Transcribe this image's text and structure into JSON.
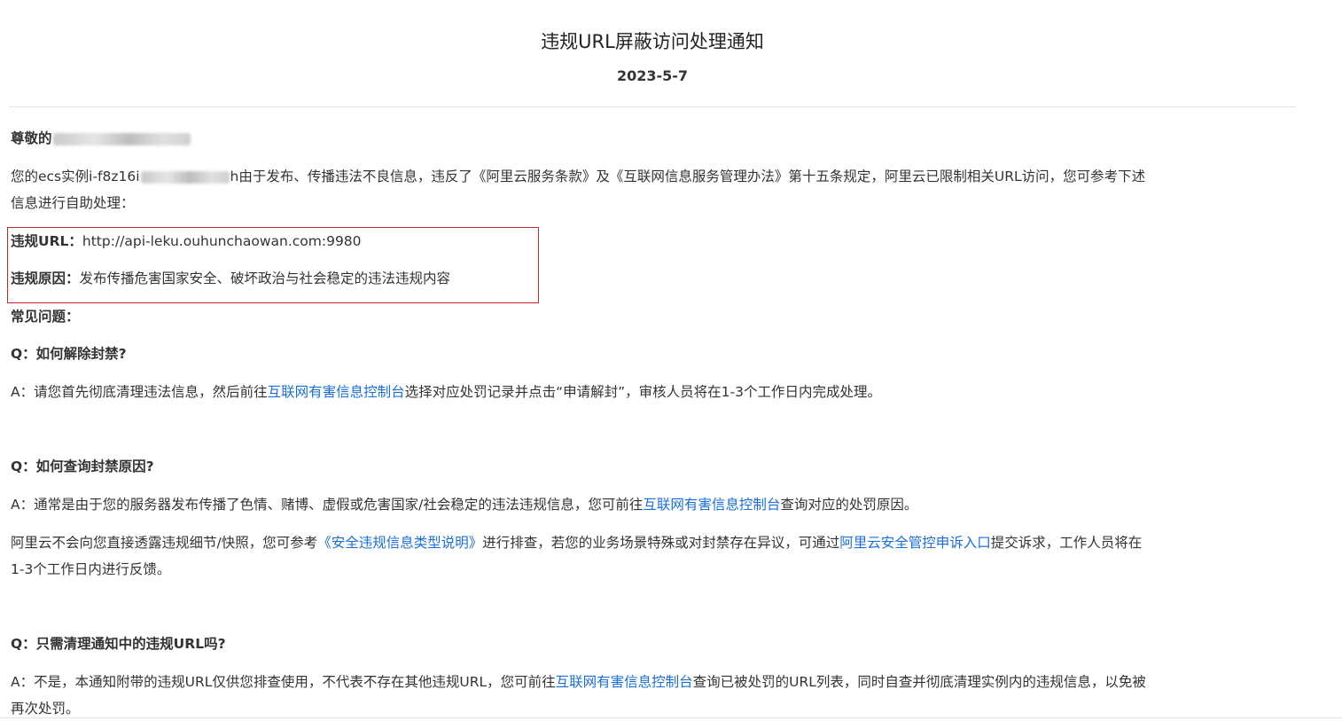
{
  "notice": {
    "title": "违规URL屏蔽访问处理通知",
    "date": "2023-5-7",
    "greeting_prefix": "尊敬的",
    "intro_prefix": "您的ecs实例i-f8z16i",
    "intro_suffix": "h由于发布、传播违法不良信息，违反了《阿里云服务条款》及《互联网信息服务管理办法》第十五条规定，阿里云已限制相关URL访问，您可参考下述",
    "intro_line2": "信息进行自助处理："
  },
  "violation": {
    "url_label": "违规URL：",
    "url_value": "http://api-leku.ouhunchaowan.com:9980",
    "reason_label": "违规原因：",
    "reason_value": "发布传播危害国家安全、破坏政治与社会稳定的违法违规内容"
  },
  "faq": {
    "heading": "常见问题：",
    "q1": "Q：如何解除封禁?",
    "a1_prefix": "A：请您首先彻底清理违法信息，然后前往",
    "a1_link": "互联网有害信息控制台",
    "a1_suffix": "选择对应处罚记录并点击“申请解封”，审核人员将在1-3个工作日内完成处理。",
    "q2": "Q：如何查询封禁原因?",
    "a2_prefix": "A：通常是由于您的服务器发布传播了色情、赌博、虚假或危害国家/社会稳定的违法违规信息，您可前往",
    "a2_link": "互联网有害信息控制台",
    "a2_suffix": "查询对应的处罚原因。",
    "a2b_prefix": "阿里云不会向您直接透露违规细节/快照，您可参考",
    "a2b_link1": "《安全违规信息类型说明》",
    "a2b_mid": "进行排查，若您的业务场景特殊或对封禁存在异议，可通过",
    "a2b_link2": "阿里云安全管控申诉入口",
    "a2b_suffix": "提交诉求，工作人员将在",
    "a2b_line2": "1-3个工作日内进行反馈。",
    "q3": "Q：只需清理通知中的违规URL吗?",
    "a3_prefix": "A：不是，本通知附带的违规URL仅供您排查使用，不代表不存在其他违规URL，您可前往",
    "a3_link": "互联网有害信息控制台",
    "a3_suffix": "查询已被处罚的URL列表，同时自查并彻底清理实例内的违规信息，以免被",
    "a3_line2": "再次处罚。"
  },
  "colors": {
    "link": "#1a6fd6",
    "highlight_border": "#c62828"
  }
}
